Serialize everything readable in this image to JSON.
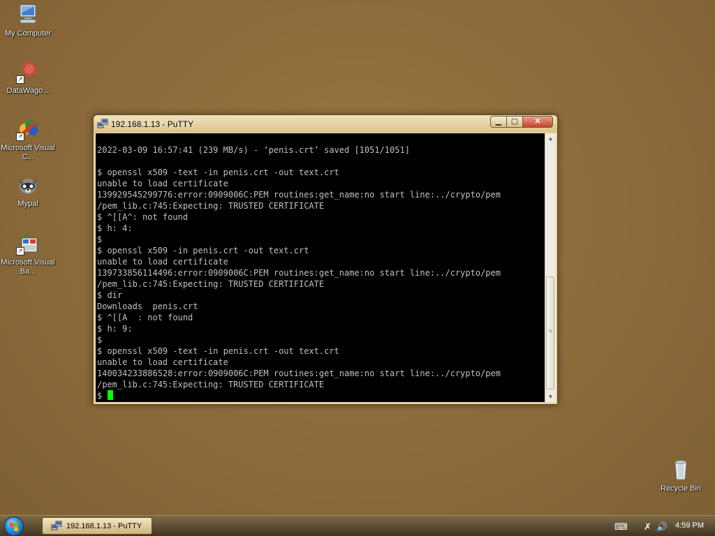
{
  "desktop": {
    "icons": [
      {
        "label": "My Computer",
        "icon": "computer-icon"
      },
      {
        "label": "DataWago...",
        "icon": "datawagon-icon"
      },
      {
        "label": "Microsoft Visual C...",
        "icon": "visual-cpp-icon"
      },
      {
        "label": "Mypal",
        "icon": "mypal-icon"
      },
      {
        "label": "Microsoft Visual Ba...",
        "icon": "visual-basic-icon"
      },
      {
        "label": "Recycle Bin",
        "icon": "recycle-bin-icon"
      }
    ]
  },
  "window": {
    "title": "192.168.1.13 - PuTTY",
    "buttons": {
      "minimize": "minimize",
      "maximize": "maximize",
      "close": "close"
    }
  },
  "terminal": {
    "lines": [
      "2022-03-09 16:57:41 (239 MB/s) - ‘penis.crt’ saved [1051/1051]",
      "",
      "$ openssl x509 -text -in penis.crt -out text.crt",
      "unable to load certificate",
      "139929545299776:error:0909006C:PEM routines:get_name:no start line:../crypto/pem",
      "/pem_lib.c:745:Expecting: TRUSTED CERTIFICATE",
      "$ ^[[A^: not found",
      "$ h: 4:",
      "$",
      "$ openssl x509 -in penis.crt -out text.crt",
      "unable to load certificate",
      "139733856114496:error:0909006C:PEM routines:get_name:no start line:../crypto/pem",
      "/pem_lib.c:745:Expecting: TRUSTED CERTIFICATE",
      "$ dir",
      "Downloads  penis.crt",
      "$ ^[[A  : not found",
      "$ h: 9:",
      "$",
      "$ openssl x509 -text -in penis.crt -out text.crt",
      "unable to load certificate",
      "140034233886528:error:0909006C:PEM routines:get_name:no start line:../crypto/pem",
      "/pem_lib.c:745:Expecting: TRUSTED CERTIFICATE"
    ],
    "prompt": "$",
    "colors": {
      "background": "#000000",
      "text": "#c0c0c0",
      "cursor": "#00ff00"
    }
  },
  "taskbar": {
    "start_icon": "windows-start-icon",
    "task_label": "192.168.1.13 - PuTTY",
    "clock": "4:59 PM",
    "tray_icons": [
      "keyboard-icon",
      "network-x-icon",
      "speaker-icon"
    ]
  }
}
